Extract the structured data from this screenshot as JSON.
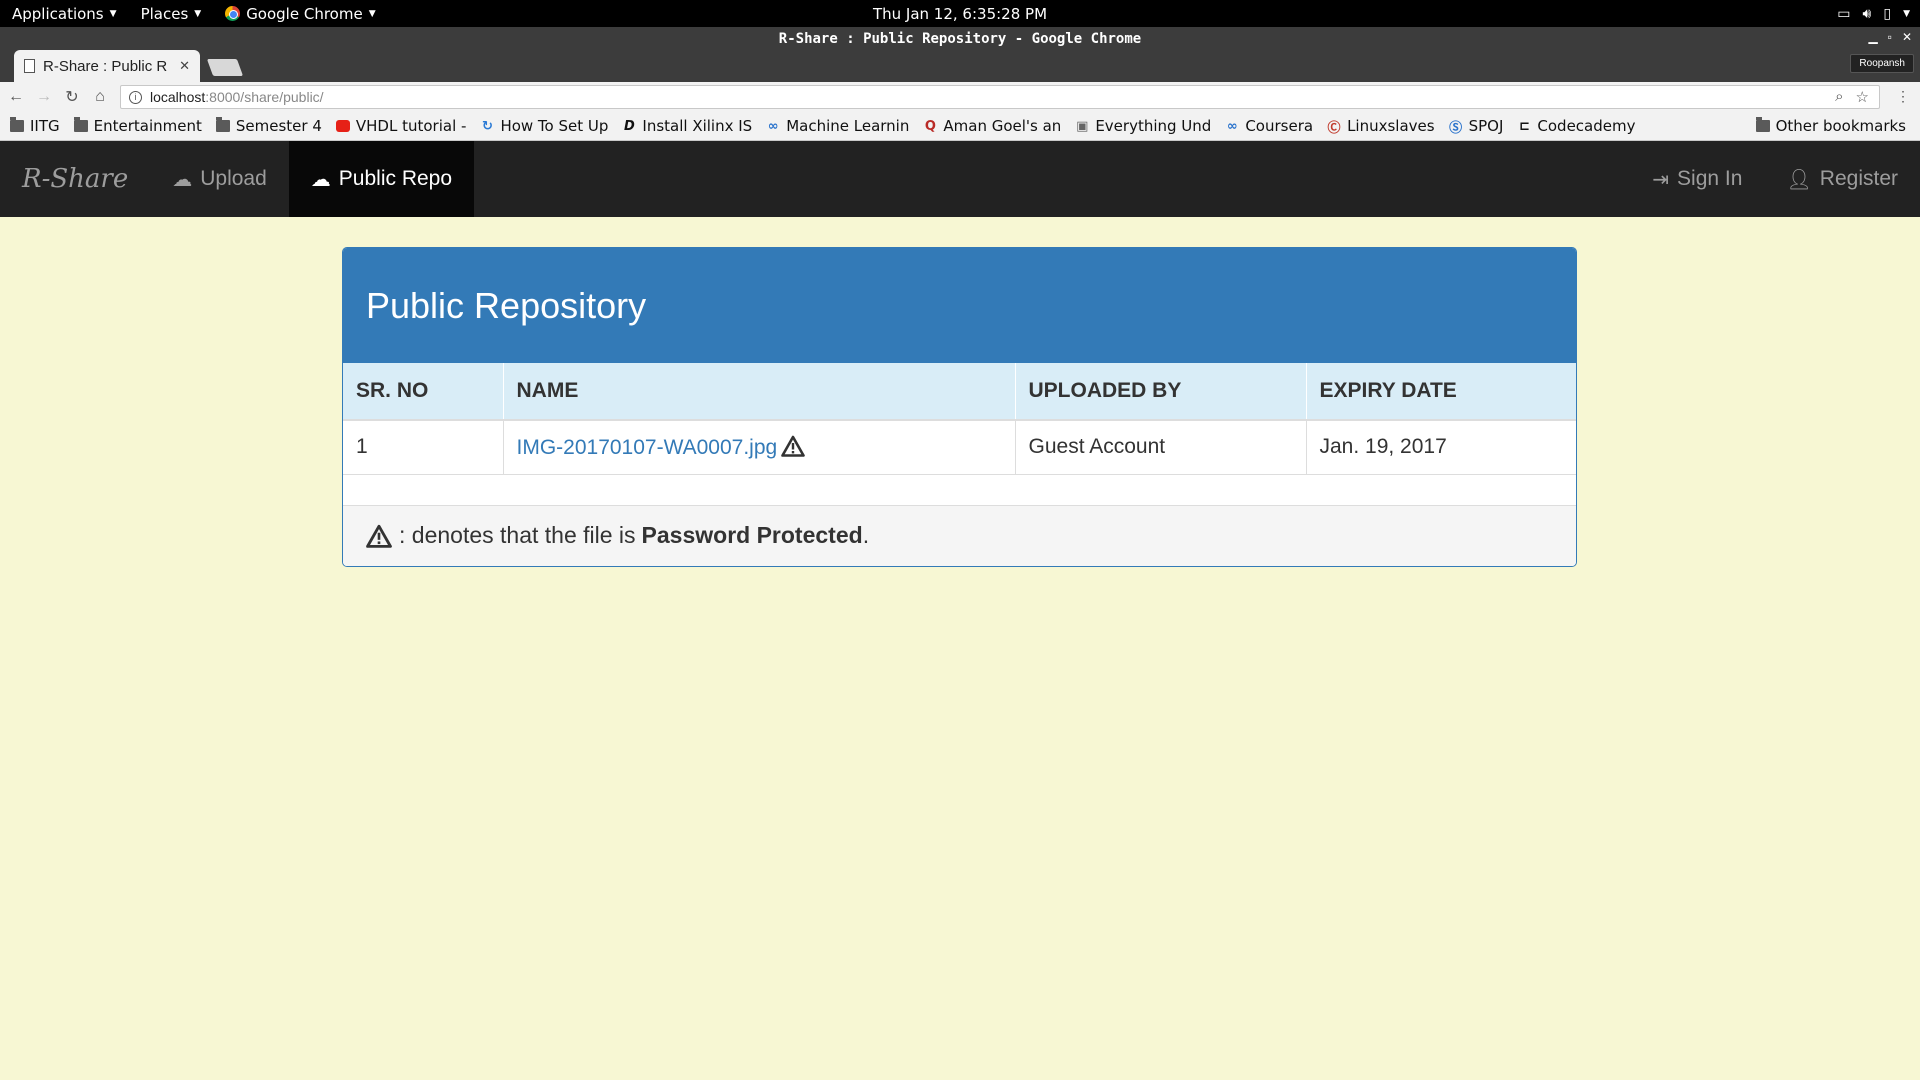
{
  "system_bar": {
    "applications": "Applications",
    "places": "Places",
    "active_app": "Google Chrome",
    "clock": "Thu Jan 12,  6:35:28 PM"
  },
  "window": {
    "title": "R-Share : Public Repository - Google Chrome",
    "profile": "Roopansh",
    "tab_title": "R-Share : Public R"
  },
  "address_bar": {
    "host": "localhost",
    "path": ":8000/share/public/"
  },
  "bookmarks": [
    {
      "label": "IITG",
      "icon": "folder-icon"
    },
    {
      "label": "Entertainment",
      "icon": "folder-icon"
    },
    {
      "label": "Semester 4",
      "icon": "folder-icon"
    },
    {
      "label": "VHDL tutorial -",
      "icon": "youtube-icon"
    },
    {
      "label": "How To Set Up",
      "icon": "refresh-favicon"
    },
    {
      "label": "Install Xilinx IS",
      "icon": "d-favicon"
    },
    {
      "label": "Machine Learnin",
      "icon": "coursera-icon"
    },
    {
      "label": "Aman Goel's an",
      "icon": "quora-icon"
    },
    {
      "label": "Everything Und",
      "icon": "site-favicon"
    },
    {
      "label": "Coursera",
      "icon": "coursera-icon"
    },
    {
      "label": "Linuxslaves",
      "icon": "linuxslaves-icon"
    },
    {
      "label": "SPOJ",
      "icon": "spoj-icon"
    },
    {
      "label": "Codecademy",
      "icon": "codecademy-icon"
    }
  ],
  "other_bookmarks": "Other bookmarks",
  "nav": {
    "brand": "R-Share",
    "upload": "Upload",
    "public_repo": "Public Repo",
    "sign_in": "Sign In",
    "register": "Register"
  },
  "panel": {
    "heading": "Public Repository",
    "columns": [
      "SR. NO",
      "NAME",
      "UPLOADED BY",
      "EXPIRY DATE"
    ],
    "rows": [
      {
        "sr": "1",
        "name": "IMG-20170107-WA0007.jpg",
        "uploaded_by": "Guest Account",
        "expiry": "Jan. 19, 2017"
      }
    ],
    "footer_text": ": denotes that the file is",
    "footer_bold": "Password Protected",
    "footer_end": "."
  },
  "colors": {
    "page_bg": "#f7f7d3",
    "navbar": "#222222",
    "primary": "#337ab7",
    "table_header": "#d9edf7"
  }
}
